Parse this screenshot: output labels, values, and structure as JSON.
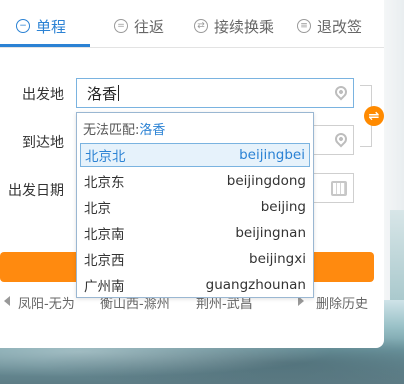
{
  "tabs": [
    {
      "label": "单程",
      "icon": "minus-circle-icon",
      "glyph": "−",
      "active": true
    },
    {
      "label": "往返",
      "icon": "equals-circle-icon",
      "glyph": "=",
      "active": false
    },
    {
      "label": "接续换乘",
      "icon": "transfer-circle-icon",
      "glyph": "⇄",
      "active": false
    },
    {
      "label": "退改签",
      "icon": "refund-circle-icon",
      "glyph": "≡",
      "active": false
    }
  ],
  "form": {
    "departure_label": "出发地",
    "departure_value": "洛香",
    "arrival_label": "到达地",
    "date_label": "出发日期"
  },
  "dropdown": {
    "no_match_prefix": "无法匹配:",
    "no_match_term": "洛香",
    "options": [
      {
        "name": "北京北",
        "pinyin": "beijingbei",
        "selected": true
      },
      {
        "name": "北京东",
        "pinyin": "beijingdong",
        "selected": false
      },
      {
        "name": "北京",
        "pinyin": "beijing",
        "selected": false
      },
      {
        "name": "北京南",
        "pinyin": "beijingnan",
        "selected": false
      },
      {
        "name": "北京西",
        "pinyin": "beijingxi",
        "selected": false
      },
      {
        "name": "广州南",
        "pinyin": "guangzhounan",
        "selected": false
      }
    ]
  },
  "history": {
    "items": [
      "凤阳-无为",
      "衡山西-滁州",
      "荆州-武昌"
    ],
    "delete_label": "删除历史"
  },
  "colors": {
    "accent_blue": "#2b82d4",
    "orange": "#ff8a0f"
  }
}
